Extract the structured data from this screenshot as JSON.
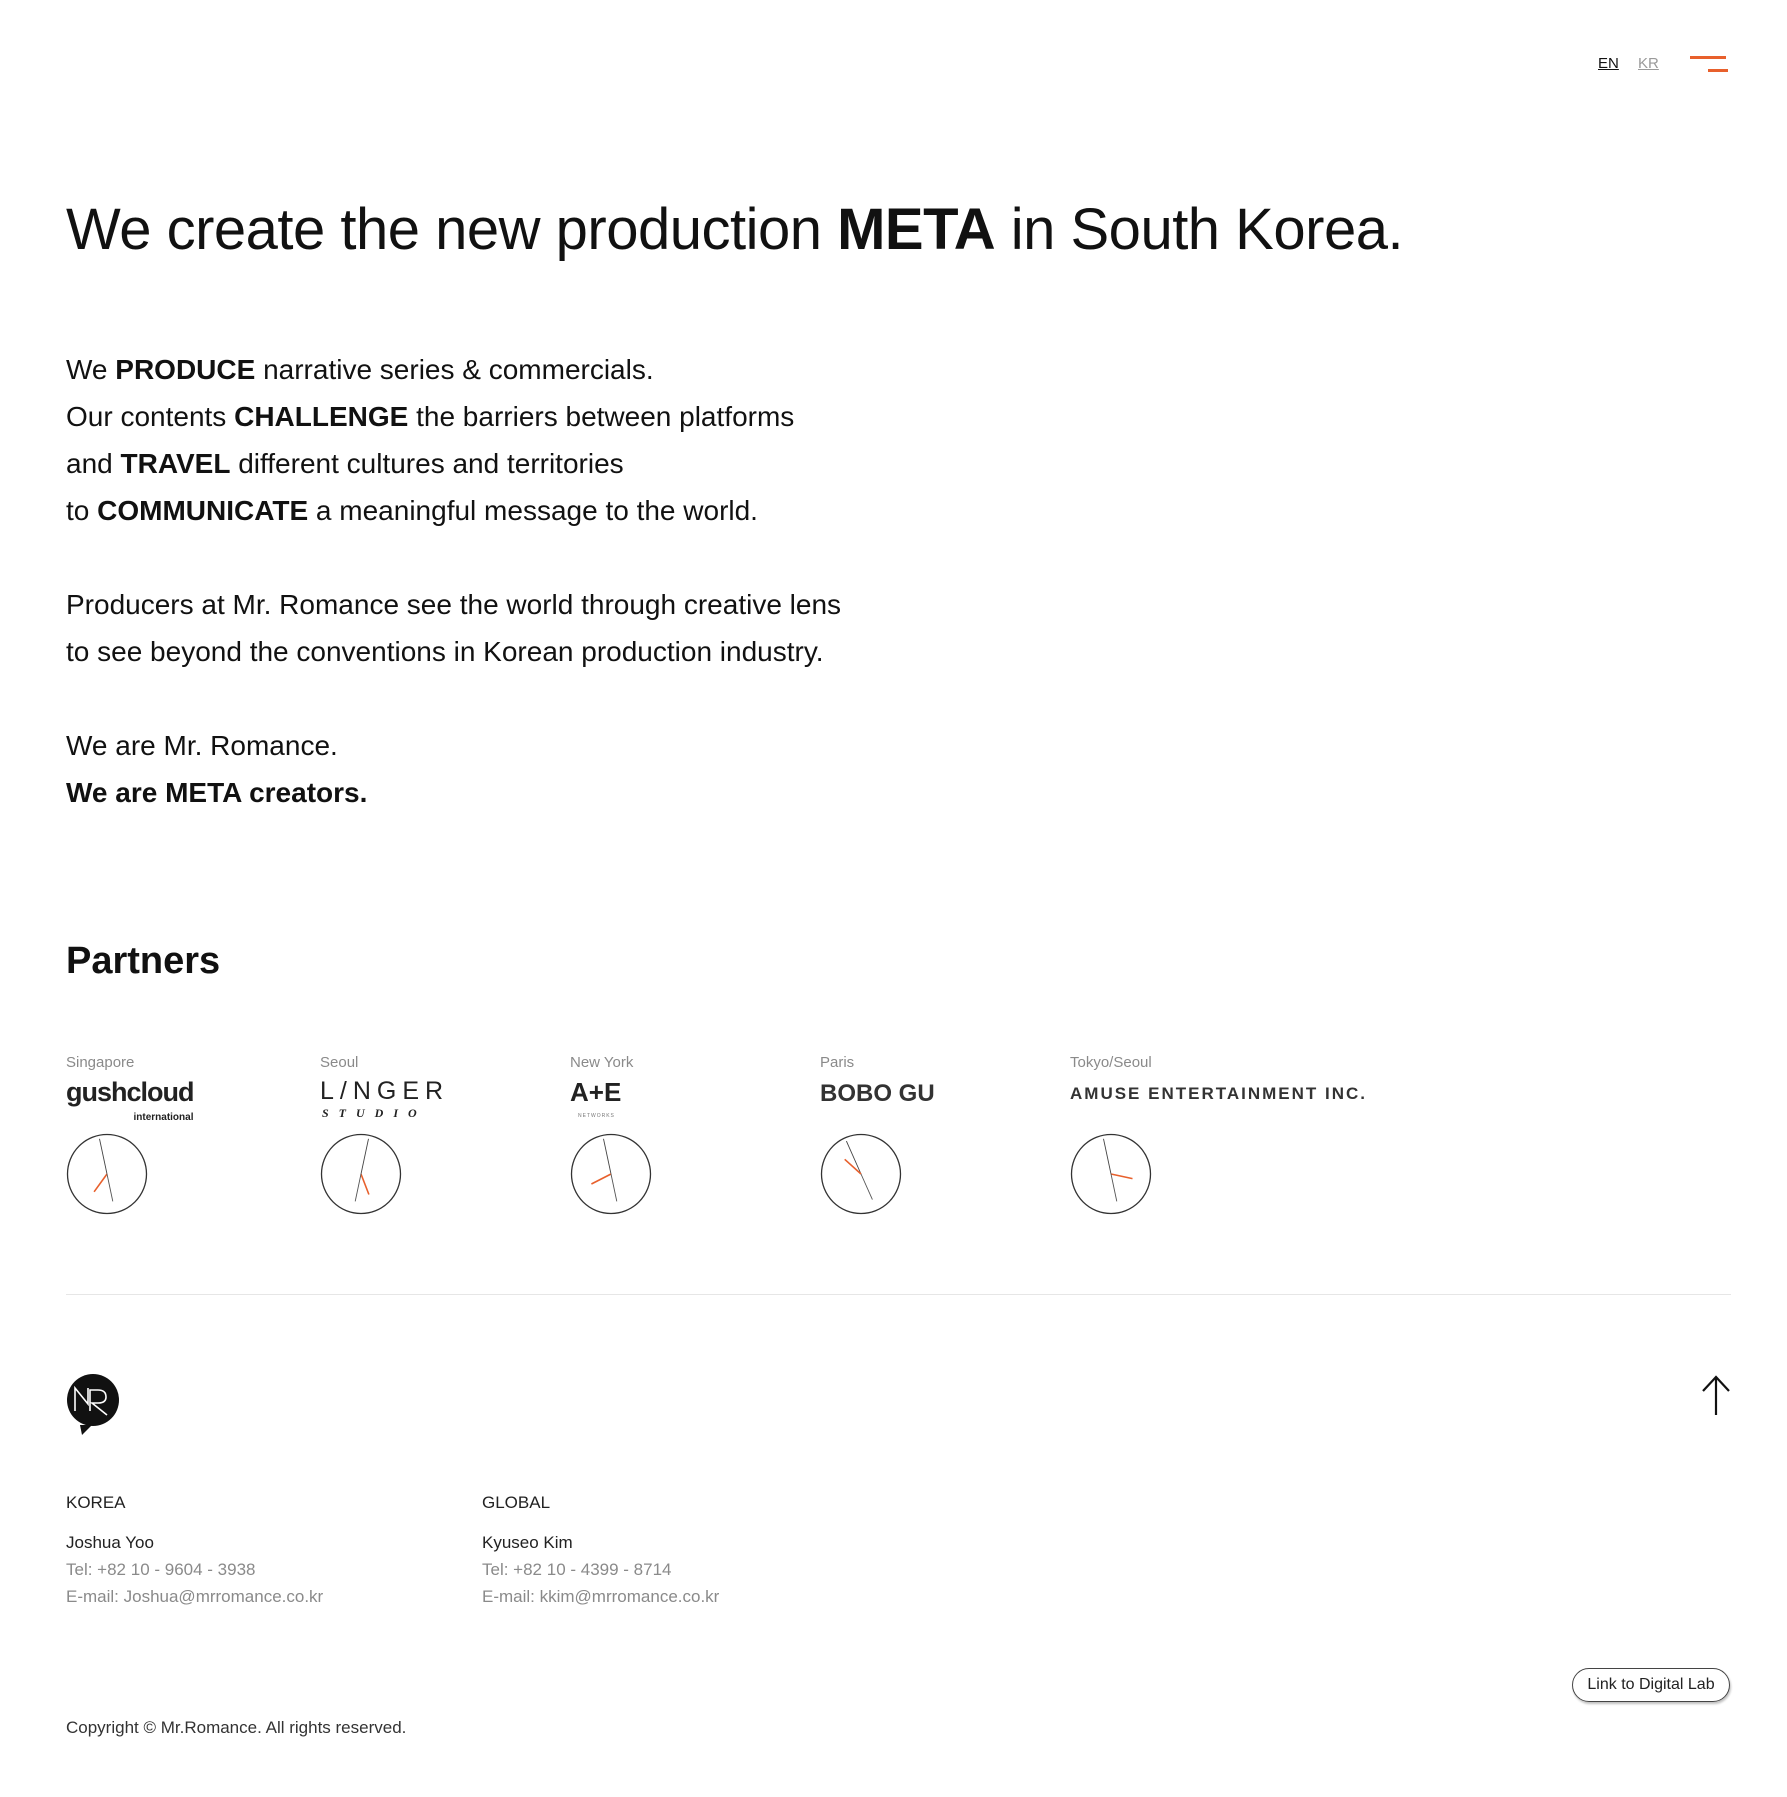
{
  "header": {
    "lang_en": "EN",
    "lang_kr": "KR",
    "menu_icon": "hamburger-menu-icon",
    "accent_color": "#e8602c"
  },
  "headline": {
    "pre": "We create the new production ",
    "bold": "META",
    "post": " in South Korea."
  },
  "intro": {
    "l1_a": "We ",
    "l1_b": "PRODUCE",
    "l1_c": " narrative series & commercials.",
    "l2_a": "Our contents ",
    "l2_b": "CHALLENGE",
    "l2_c": " the barriers between platforms",
    "l3_a": "and ",
    "l3_b": "TRAVEL",
    "l3_c": " different cultures and territories",
    "l4_a": "to ",
    "l4_b": "COMMUNICATE",
    "l4_c": " a meaningful message to the world.",
    "p2_l1": "Producers at Mr. Romance see the world through creative lens",
    "p2_l2": "to see beyond the conventions in Korean production industry.",
    "p3_l1": "We are Mr. Romance.",
    "p3_l2": "We are META creators."
  },
  "partners": {
    "title": "Partners",
    "items": [
      {
        "city": "Singapore",
        "logo_main": "gushcloud",
        "logo_sub": "international"
      },
      {
        "city": "Seoul",
        "logo_main": "L/NGER",
        "logo_sub": "STUDIO"
      },
      {
        "city": "New York",
        "logo_main": "A+E",
        "logo_sub": "NETWORKS"
      },
      {
        "city": "Paris",
        "logo_main": "BOBO GU"
      },
      {
        "city": "Tokyo/Seoul",
        "logo_main": "AMUSE",
        "logo_sub": " ENTERTAINMENT INC."
      }
    ],
    "clock_hand_color": "#e8602c"
  },
  "footer": {
    "logo": "mr-romance-logo",
    "to_top_icon": "arrow-up-icon",
    "korea": {
      "region": "KOREA",
      "name": "Joshua Yoo",
      "tel": "Tel: +82 10 - 9604 - 3938",
      "email": "E-mail: Joshua@mrromance.co.kr"
    },
    "global": {
      "region": "GLOBAL",
      "name": "Kyuseo Kim",
      "tel": "Tel: +82 10 - 4399 - 8714",
      "email": "E-mail: kkim@mrromance.co.kr"
    },
    "digital_lab": "Link to Digital Lab",
    "copyright": "Copyright © Mr.Romance. All rights reserved."
  }
}
